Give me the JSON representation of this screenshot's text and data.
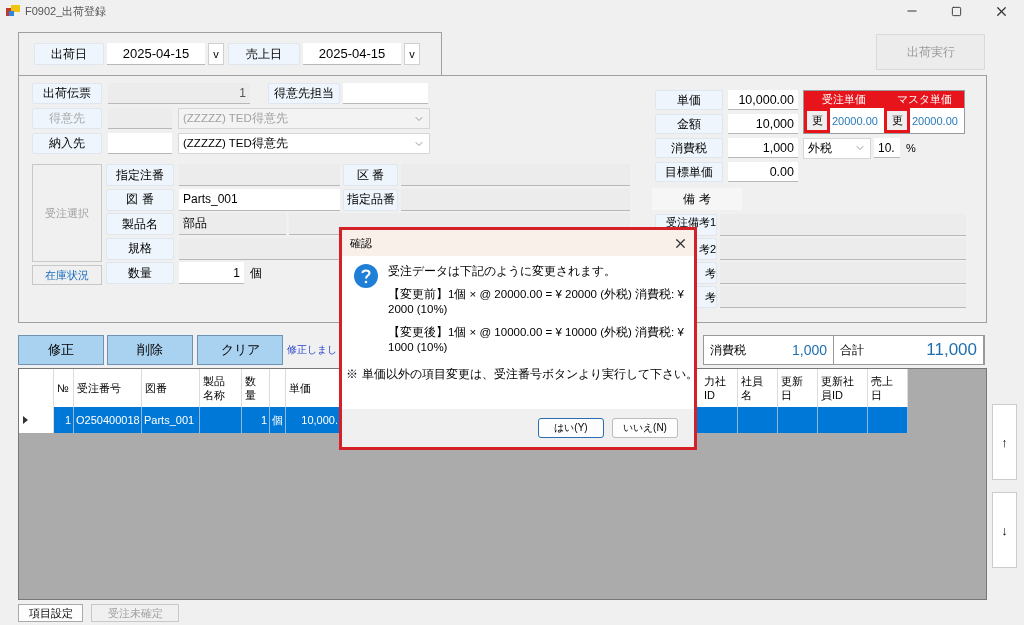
{
  "window": {
    "title": "F0902_出荷登録"
  },
  "dates": [
    {
      "label": "出荷日",
      "value": "2025-04-15",
      "button": "v"
    },
    {
      "label": "売上日",
      "value": "2025-04-15",
      "button": "v"
    }
  ],
  "ship_button": {
    "label": "出荷実行",
    "disabled": true
  },
  "slip": {
    "label": "出荷伝票",
    "value": "1",
    "rep_label": "得意先担当"
  },
  "customer": {
    "label": "得意先",
    "value": "(ZZZZZ) TED得意先",
    "disabled": true
  },
  "delivery": {
    "label": "納入先",
    "value": "(ZZZZZ) TED得意先",
    "disabled": false
  },
  "order_select": {
    "label": "受注選択",
    "disabled": true
  },
  "stock_link": "在庫状況",
  "product_fields": [
    {
      "label": "指定注番",
      "readonly": true
    },
    {
      "label": "図 番",
      "value": "Parts_001",
      "readonly": false
    },
    {
      "label": "製品名",
      "value": "部品",
      "readonly": true
    },
    {
      "label": "規格",
      "readonly": true
    },
    {
      "label": "数量",
      "value": "1",
      "unit": "個",
      "readonly": false
    }
  ],
  "side_fields": [
    {
      "label": "区 番"
    },
    {
      "label": "指定品番"
    }
  ],
  "prices": [
    {
      "label": "単価",
      "value": "10,000.00"
    },
    {
      "label": "金額",
      "value": "10,000"
    },
    {
      "label": "消費税",
      "value": "1,000"
    },
    {
      "label": "目標単価",
      "value": "0.00"
    }
  ],
  "tax": {
    "mode": "外税",
    "rate": "10.",
    "unit": "%"
  },
  "price_compare": [
    {
      "header": "受注単価",
      "button": "更",
      "value": "20000.00"
    },
    {
      "header": "マスタ単価",
      "button": "更",
      "value": "20000.00"
    }
  ],
  "remarks": {
    "title": "備 考",
    "rows": [
      {
        "label": "受注備考1"
      },
      {
        "label": "考2"
      },
      {
        "label": "考"
      },
      {
        "label": "考"
      }
    ]
  },
  "actions": [
    {
      "label": "修正"
    },
    {
      "label": "削除"
    },
    {
      "label": "クリア"
    }
  ],
  "message": "修正しまし",
  "totals": [
    {
      "label": "消費税",
      "value": "1,000"
    },
    {
      "label": "合計",
      "value": "11,000"
    }
  ],
  "table": {
    "columns_left": [
      {
        "label": "№",
        "kind": "number"
      },
      {
        "label": "受注番号",
        "kind": "text"
      },
      {
        "label": "図番",
        "kind": "text"
      },
      {
        "label": "製品名称",
        "kind": "text"
      },
      {
        "label": "数量",
        "kind": "number"
      },
      {
        "kind": "unit"
      },
      {
        "label": "単価",
        "kind": "number"
      }
    ],
    "columns_right": [
      {
        "label": "力社ID"
      },
      {
        "label": "社員名"
      },
      {
        "label": "更新日"
      },
      {
        "label": "更新社員ID"
      },
      {
        "label": "売上日"
      }
    ],
    "rows": [
      {
        "selected": true,
        "cells_left": [
          {
            "kind": "text",
            "text": "1"
          },
          {
            "kind": "text",
            "text": "O250400018"
          },
          {
            "kind": "text",
            "text": "Parts_001"
          },
          {
            "kind": "empty"
          },
          {
            "kind": "text",
            "text": "1"
          },
          {
            "kind": "text",
            "text": "個"
          },
          {
            "kind": "text",
            "text": "10,000."
          }
        ]
      }
    ]
  },
  "scroll_buttons": [
    "↑",
    "↓"
  ],
  "footer": {
    "settings": "項目設定",
    "status": {
      "label": "受注未確定",
      "disabled": true
    }
  },
  "dialog": {
    "title": "確認",
    "message": "受注データは下記のように変更されます。",
    "lines": [
      "【変更前】1個 × @ 20000.00 = ¥ 20000 (外税)  消費税: ¥ 2000 (10%)",
      "【変更後】1個 × @ 10000.00 = ¥ 10000 (外税)  消費税: ¥ 1000 (10%)"
    ],
    "note": "※ 単価以外の項目変更は、受注番号ボタンより実行して下さい。",
    "buttons": [
      {
        "label": "はい(Y)",
        "default": true
      },
      {
        "label": "いいえ(N)",
        "default": false
      }
    ]
  }
}
